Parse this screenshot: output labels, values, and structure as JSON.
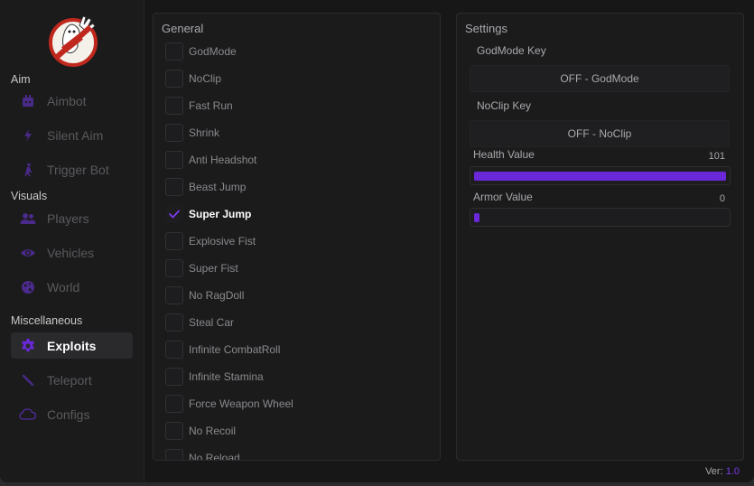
{
  "colors": {
    "accent": "#6a28d9",
    "background": "#171717",
    "panel": "#1b1b1c"
  },
  "sidebar": {
    "logo": "ghostbusters-logo",
    "sections": [
      {
        "label": "Aim",
        "items": [
          {
            "label": "Aimbot",
            "icon": "robot-icon"
          },
          {
            "label": "Silent Aim",
            "icon": "lightning-icon"
          },
          {
            "label": "Trigger Bot",
            "icon": "running-person-icon"
          }
        ]
      },
      {
        "label": "Visuals",
        "items": [
          {
            "label": "Players",
            "icon": "users-icon"
          },
          {
            "label": "Vehicles",
            "icon": "eye-icon"
          },
          {
            "label": "World",
            "icon": "globe-icon"
          }
        ]
      },
      {
        "label": "Miscellaneous",
        "items": [
          {
            "label": "Exploits",
            "icon": "gear-icon",
            "active": true
          },
          {
            "label": "Teleport",
            "icon": "wand-icon"
          },
          {
            "label": "Configs",
            "icon": "cloud-icon"
          }
        ]
      }
    ]
  },
  "general": {
    "title": "General",
    "options": [
      {
        "label": "GodMode",
        "checked": false
      },
      {
        "label": "NoClip",
        "checked": false
      },
      {
        "label": "Fast Run",
        "checked": false
      },
      {
        "label": "Shrink",
        "checked": false
      },
      {
        "label": "Anti Headshot",
        "checked": false
      },
      {
        "label": "Beast Jump",
        "checked": false
      },
      {
        "label": "Super Jump",
        "checked": true
      },
      {
        "label": "Explosive Fist",
        "checked": false
      },
      {
        "label": "Super Fist",
        "checked": false
      },
      {
        "label": "No RagDoll",
        "checked": false
      },
      {
        "label": "Steal Car",
        "checked": false
      },
      {
        "label": "Infinite CombatRoll",
        "checked": false
      },
      {
        "label": "Infinite Stamina",
        "checked": false
      },
      {
        "label": "Force Weapon Wheel",
        "checked": false
      },
      {
        "label": "No Recoil",
        "checked": false
      },
      {
        "label": "No Reload",
        "checked": false
      }
    ]
  },
  "settings": {
    "title": "Settings",
    "godmode_key_label": "GodMode Key",
    "godmode_key_value": "OFF - GodMode",
    "noclip_key_label": "NoClip Key",
    "noclip_key_value": "OFF - NoClip",
    "health_label": "Health Value",
    "health_value": "101",
    "health_fraction": 1.0,
    "armor_label": "Armor Value",
    "armor_value": "0",
    "armor_fraction": 0.0
  },
  "footer": {
    "version_label": "Ver:",
    "version_number": "1.0"
  }
}
